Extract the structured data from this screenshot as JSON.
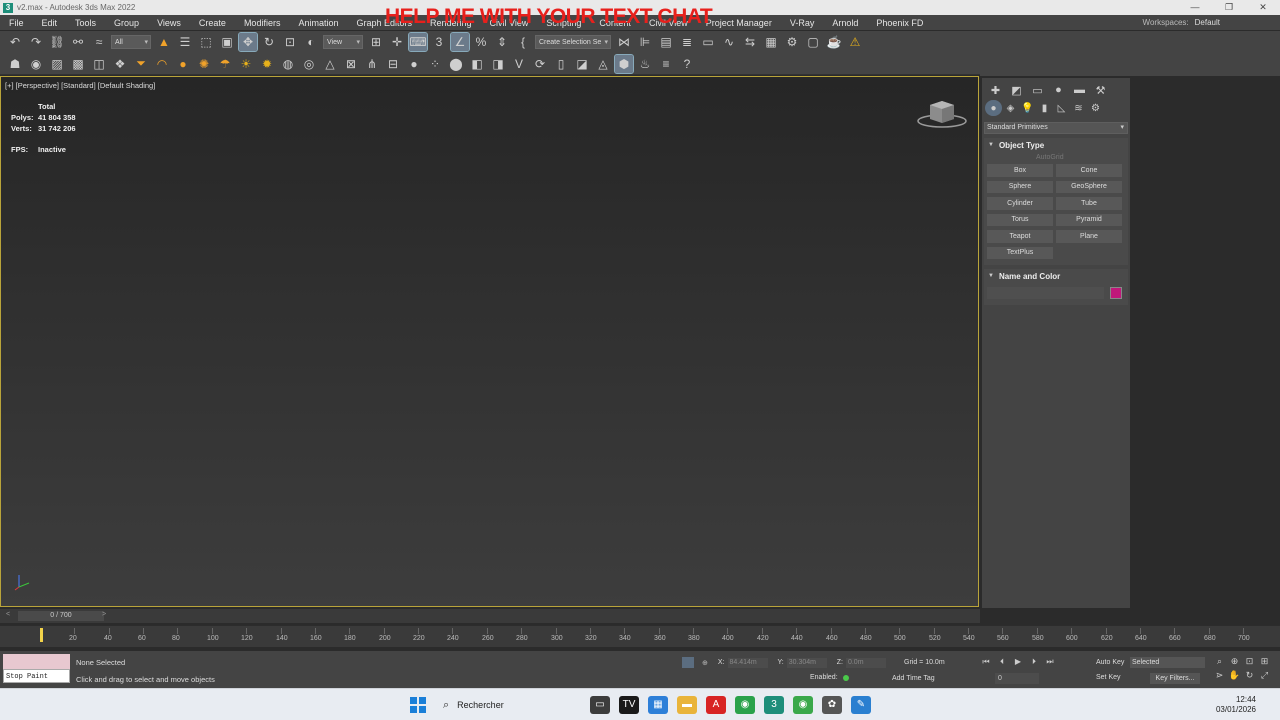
{
  "window": {
    "title": "v2.max - Autodesk 3ds Max 2022",
    "controls": [
      "—",
      "❐",
      "✕"
    ],
    "app_icon": "3"
  },
  "overlay_text": "HELP ME WITH YOUR TEXT CHAT",
  "menu": {
    "items": [
      "File",
      "Edit",
      "Tools",
      "Group",
      "Views",
      "Create",
      "Modifiers",
      "Animation",
      "Graph Editors",
      "Rendering",
      "Civil View",
      "Scripting",
      "Content",
      "Civil View",
      "Project Manager",
      "V-Ray",
      "Arnold",
      "Phoenix FD"
    ],
    "workspaces_label": "Workspaces:",
    "workspaces_value": "Default"
  },
  "toolbar": {
    "filter_value": "All",
    "view_value": "View",
    "selection_set_placeholder": "Create Selection Se"
  },
  "viewport": {
    "label": "[+] [Perspective] [Standard] [Default Shading]",
    "stats": {
      "total_label": "Total",
      "polys_label": "Polys:",
      "polys_value": "41 804 358",
      "verts_label": "Verts:",
      "verts_value": "31 742 206",
      "fps_label": "FPS:",
      "fps_value": "Inactive"
    }
  },
  "command_panel": {
    "category": "Standard Primitives",
    "object_type_title": "Object Type",
    "autogrid_label": "AutoGrid",
    "buttons": [
      "Box",
      "Cone",
      "Sphere",
      "GeoSphere",
      "Cylinder",
      "Tube",
      "Torus",
      "Pyramid",
      "Teapot",
      "Plane",
      "TextPlus"
    ],
    "name_color_title": "Name and Color",
    "object_color": "#c0187a"
  },
  "timeline": {
    "slider_value": "0 / 700",
    "ruler_labels": [
      "20",
      "40",
      "60",
      "80",
      "100",
      "120",
      "140",
      "160",
      "180",
      "200",
      "220",
      "240",
      "260",
      "280",
      "300",
      "320",
      "340",
      "360",
      "380",
      "400",
      "420",
      "440",
      "460",
      "480",
      "500",
      "520",
      "540",
      "560",
      "580",
      "600",
      "620",
      "640",
      "660",
      "680",
      "700"
    ]
  },
  "status": {
    "maxscript_text": "Stop Paint",
    "selection": "None Selected",
    "prompt": "Click and drag to select and move objects",
    "x_label": "X:",
    "x_value": "84.414m",
    "y_label": "Y:",
    "y_value": "30.304m",
    "z_label": "Z:",
    "z_value": "0.0m",
    "grid": "Grid = 10.0m",
    "enabled_label": "Enabled:",
    "add_time_tag": "Add Time Tag",
    "frame_value": "0",
    "auto_key": "Auto Key",
    "set_key": "Set Key",
    "selected_dropdown": "Selected",
    "key_filters": "Key Filters..."
  },
  "taskbar": {
    "search_label": "Rechercher",
    "time": "12:44",
    "date": "03/01/2026"
  }
}
